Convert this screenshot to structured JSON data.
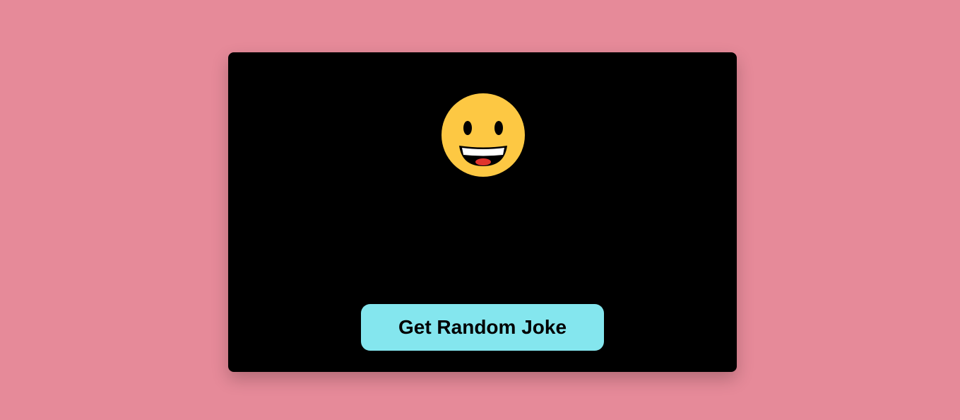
{
  "page": {
    "background_color": "#e68a99"
  },
  "card": {
    "background_color": "#000000",
    "emoji_icon": "grinning-face-icon",
    "joke_text": "",
    "button": {
      "label": "Get Random Joke",
      "color": "#84e6ee"
    }
  }
}
